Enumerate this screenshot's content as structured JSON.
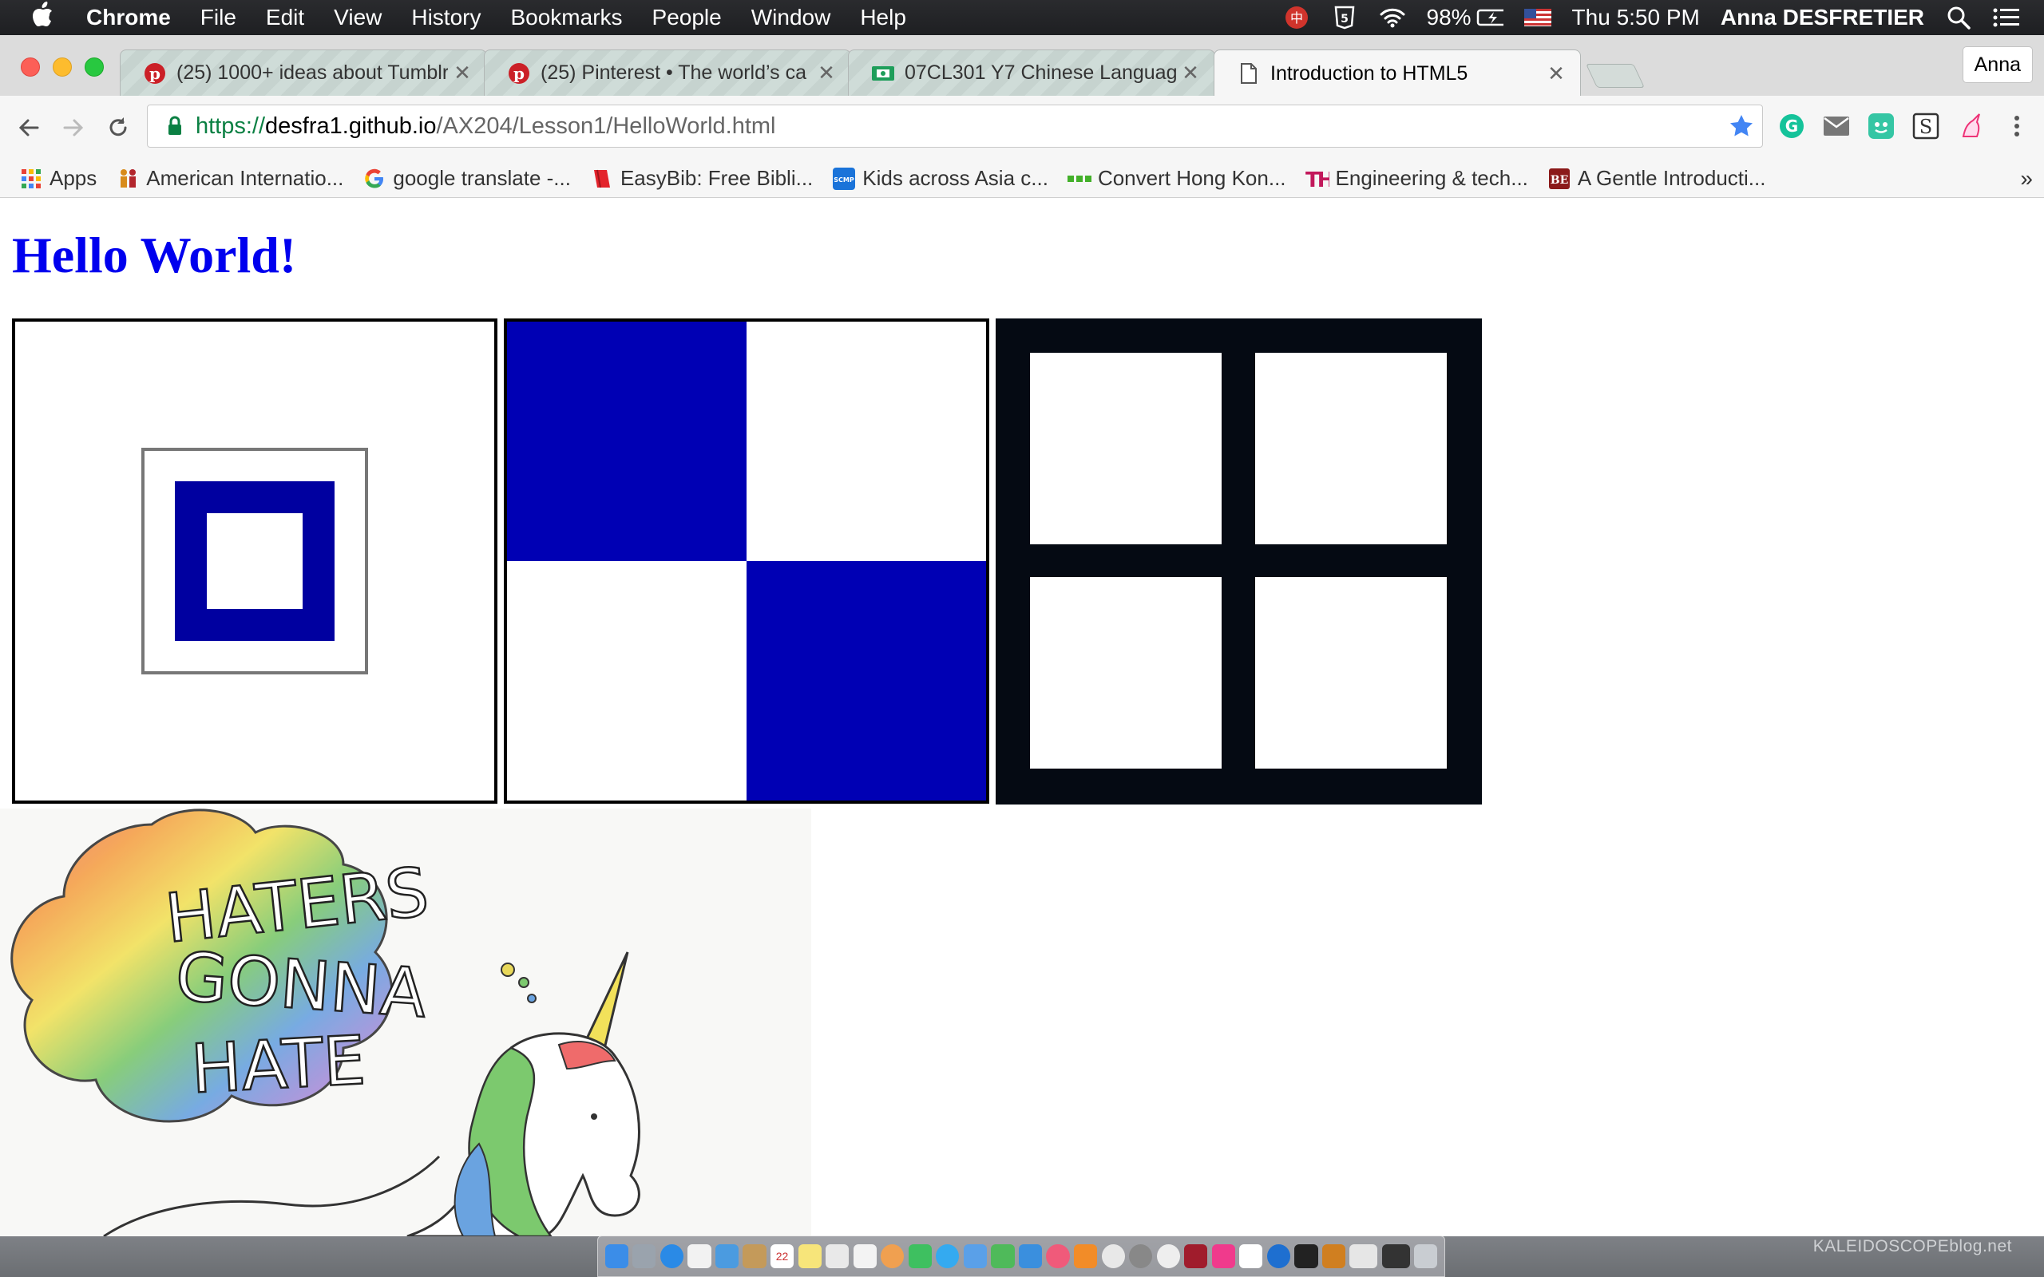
{
  "menubar": {
    "app_name": "Chrome",
    "menus": [
      "File",
      "Edit",
      "View",
      "History",
      "Bookmarks",
      "People",
      "Window",
      "Help"
    ],
    "battery": "98%",
    "clock": "Thu 5:50 PM",
    "user": "Anna DESFRETIER"
  },
  "tabs": [
    {
      "title": "(25) 1000+ ideas about Tumblr",
      "icon": "pinterest-icon",
      "active": false
    },
    {
      "title": "(25) Pinterest • The world’s ca",
      "icon": "pinterest-icon",
      "active": false
    },
    {
      "title": "07CL301 Y7 Chinese Languag",
      "icon": "classroom-icon",
      "active": false
    },
    {
      "title": "Introduction to HTML5",
      "icon": "document-icon",
      "active": true
    }
  ],
  "profile": "Anna",
  "address": {
    "scheme": "https://",
    "host": "desfra1.github.io",
    "path": "/AX204/Lesson1/HelloWorld.html"
  },
  "bookmarks": [
    {
      "label": "Apps",
      "icon": "apps-grid-icon"
    },
    {
      "label": "American Internatio...",
      "icon": "people-icon"
    },
    {
      "label": "google translate -...",
      "icon": "google-icon"
    },
    {
      "label": "EasyBib: Free Bibli...",
      "icon": "easybib-icon"
    },
    {
      "label": "Kids across Asia c...",
      "icon": "scmp-icon"
    },
    {
      "label": "Convert Hong Kon...",
      "icon": "dots-icon"
    },
    {
      "label": "Engineering & tech...",
      "icon": "the-icon"
    },
    {
      "label": "A Gentle Introducti...",
      "icon": "be-icon"
    }
  ],
  "page": {
    "heading": "Hello World!",
    "colors": {
      "heading": "#0000ee",
      "blue": "#0000b4",
      "dark": "#050a13"
    }
  },
  "watermark": "KALEIDOSCOPEblog.net"
}
